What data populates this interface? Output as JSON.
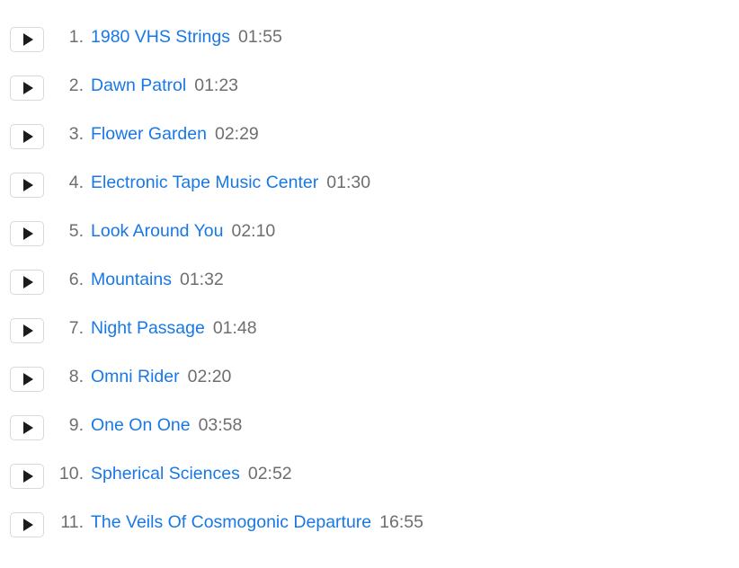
{
  "page": {
    "background_color": "#ffffff",
    "title_color": "#1878e6",
    "meta_color": "#6e6e6e",
    "button_border_color": "#d9d9d9",
    "button_glyph_color": "#1c1c1c"
  },
  "play_button": {
    "icon": "play-triangle-icon",
    "label": "Play"
  },
  "tracklist": {
    "tracks": [
      {
        "index": "1.",
        "title": "1980 VHS Strings",
        "duration": "01:55"
      },
      {
        "index": "2.",
        "title": "Dawn Patrol",
        "duration": "01:23"
      },
      {
        "index": "3.",
        "title": "Flower Garden",
        "duration": "02:29"
      },
      {
        "index": "4.",
        "title": "Electronic Tape Music Center",
        "duration": "01:30"
      },
      {
        "index": "5.",
        "title": "Look Around You",
        "duration": "02:10"
      },
      {
        "index": "6.",
        "title": "Mountains",
        "duration": "01:32"
      },
      {
        "index": "7.",
        "title": "Night Passage",
        "duration": "01:48"
      },
      {
        "index": "8.",
        "title": "Omni Rider",
        "duration": "02:20"
      },
      {
        "index": "9.",
        "title": "One On One",
        "duration": "03:58"
      },
      {
        "index": "10.",
        "title": "Spherical Sciences",
        "duration": "02:52"
      },
      {
        "index": "11.",
        "title": "The Veils Of Cosmogonic Departure",
        "duration": "16:55"
      }
    ]
  }
}
